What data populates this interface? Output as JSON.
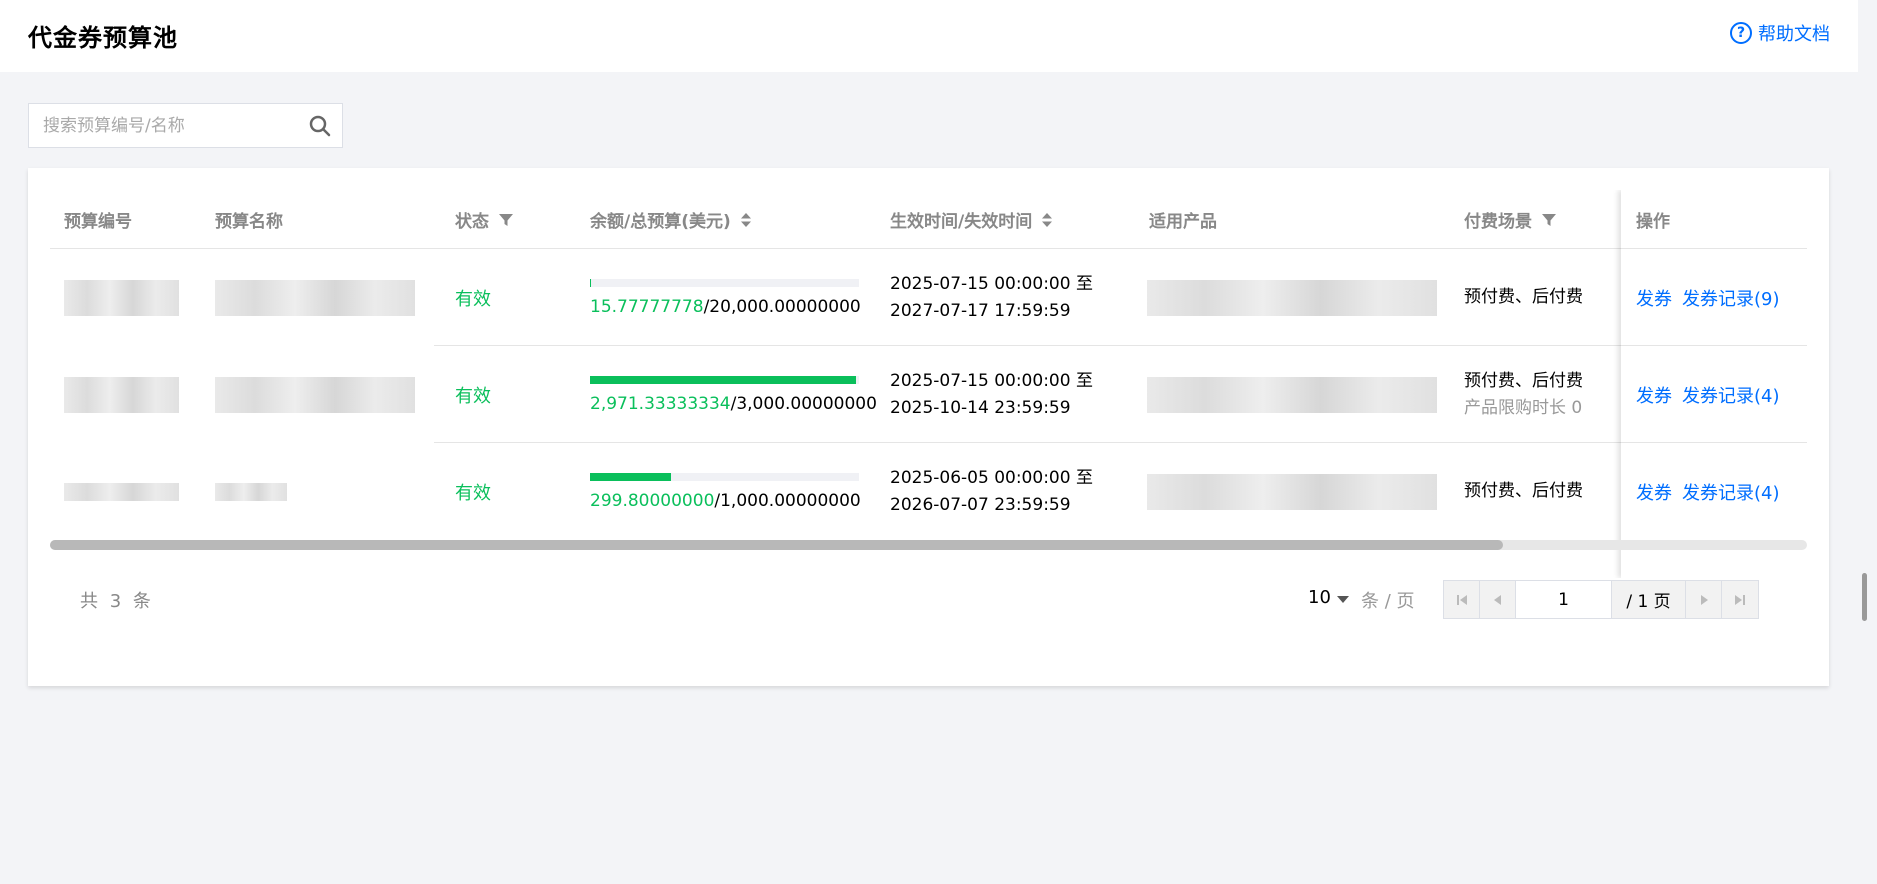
{
  "header": {
    "title": "代金券预算池",
    "help_label": "帮助文档"
  },
  "search": {
    "placeholder": "搜索预算编号/名称",
    "value": ""
  },
  "table": {
    "columns": {
      "id": "预算编号",
      "name": "预算名称",
      "status": "状态",
      "amount": "余额/总预算(美元)",
      "time": "生效时间/失效时间",
      "product": "适用产品",
      "pay": "付费场景",
      "ops": "操作"
    },
    "rows": [
      {
        "status": "有效",
        "progress": 0.0008,
        "balance": "15.77777778",
        "total": "/20,000.00000000",
        "start": "2025-07-15 00:00:00 至",
        "end": "2027-07-17 17:59:59",
        "pay": "预付费、后付费",
        "pay_sub": "",
        "issue_label": "发券",
        "record_label": "发券记录(9)"
      },
      {
        "status": "有效",
        "progress": 0.99,
        "balance": "2,971.33333334",
        "total": "/3,000.00000000",
        "start": "2025-07-15 00:00:00 至",
        "end": "2025-10-14 23:59:59",
        "pay": "预付费、后付费",
        "pay_sub": "产品限购时长 0",
        "issue_label": "发券",
        "record_label": "发券记录(4)"
      },
      {
        "status": "有效",
        "progress": 0.2998,
        "balance": "299.80000000",
        "total": "/1,000.00000000",
        "start": "2025-06-05 00:00:00 至",
        "end": "2026-07-07 23:59:59",
        "pay": "预付费、后付费",
        "pay_sub": "",
        "issue_label": "发券",
        "record_label": "发券记录(4)"
      }
    ]
  },
  "pagination": {
    "total_text": "共 3 条",
    "page_size": "10",
    "per_page_label": "条 / 页",
    "current_page": "1",
    "total_pages": "/ 1 页"
  },
  "colors": {
    "accent": "#006eff",
    "success": "#0abf5b"
  }
}
